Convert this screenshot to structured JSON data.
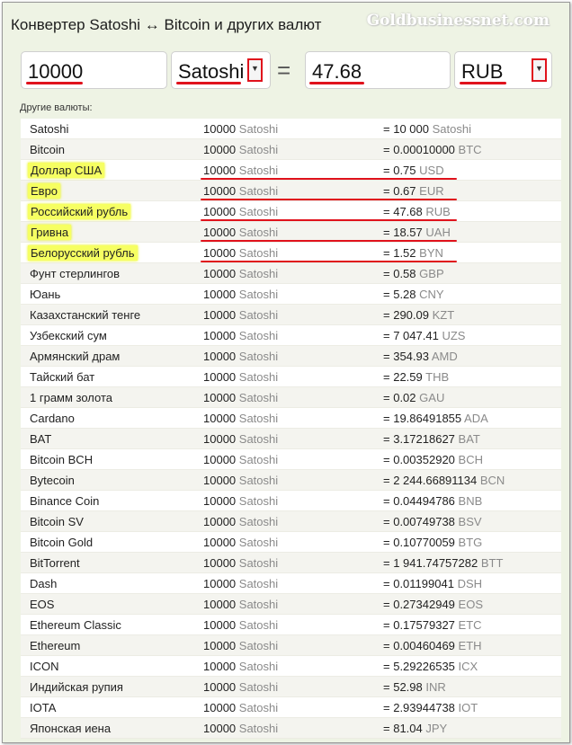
{
  "header": {
    "title": "Конвертер Satoshi ↔ Bitcoin и других валют",
    "watermark": "Goldbusinessnet.com"
  },
  "converter": {
    "amount_value": "10000",
    "from_currency": "Satoshi",
    "equals": "=",
    "result_value": "47.68",
    "to_currency": "RUB",
    "dropdown_arrow": "▼"
  },
  "others_label": "Другие валюты:",
  "colors": {
    "accent_red": "#e0121c",
    "highlight_yellow": "#f6ff62",
    "unit_gray": "#8a8a8a"
  },
  "rows": [
    {
      "name": "Satoshi",
      "amount": "10000",
      "amount_unit": "Satoshi",
      "result": "10 000",
      "unit": "Satoshi",
      "highlighted": false
    },
    {
      "name": "Bitcoin",
      "amount": "10000",
      "amount_unit": "Satoshi",
      "result": "0.00010000",
      "unit": "BTC",
      "highlighted": false
    },
    {
      "name": "Доллар США",
      "amount": "10000",
      "amount_unit": "Satoshi",
      "result": "0.75",
      "unit": "USD",
      "highlighted": true
    },
    {
      "name": "Евро",
      "amount": "10000",
      "amount_unit": "Satoshi",
      "result": "0.67",
      "unit": "EUR",
      "highlighted": true
    },
    {
      "name": "Российский рубль",
      "amount": "10000",
      "amount_unit": "Satoshi",
      "result": "47.68",
      "unit": "RUB",
      "highlighted": true
    },
    {
      "name": "Гривна",
      "amount": "10000",
      "amount_unit": "Satoshi",
      "result": "18.57",
      "unit": "UAH",
      "highlighted": true
    },
    {
      "name": "Белорусский рубль",
      "amount": "10000",
      "amount_unit": "Satoshi",
      "result": "1.52",
      "unit": "BYN",
      "highlighted": true
    },
    {
      "name": "Фунт стерлингов",
      "amount": "10000",
      "amount_unit": "Satoshi",
      "result": "0.58",
      "unit": "GBP",
      "highlighted": false
    },
    {
      "name": "Юань",
      "amount": "10000",
      "amount_unit": "Satoshi",
      "result": "5.28",
      "unit": "CNY",
      "highlighted": false
    },
    {
      "name": "Казахстанский тенге",
      "amount": "10000",
      "amount_unit": "Satoshi",
      "result": "290.09",
      "unit": "KZT",
      "highlighted": false
    },
    {
      "name": "Узбекский сум",
      "amount": "10000",
      "amount_unit": "Satoshi",
      "result": "7 047.41",
      "unit": "UZS",
      "highlighted": false
    },
    {
      "name": "Армянский драм",
      "amount": "10000",
      "amount_unit": "Satoshi",
      "result": "354.93",
      "unit": "AMD",
      "highlighted": false
    },
    {
      "name": "Тайский бат",
      "amount": "10000",
      "amount_unit": "Satoshi",
      "result": "22.59",
      "unit": "THB",
      "highlighted": false
    },
    {
      "name": "1 грамм золота",
      "amount": "10000",
      "amount_unit": "Satoshi",
      "result": "0.02",
      "unit": "GAU",
      "highlighted": false
    },
    {
      "name": "Cardano",
      "amount": "10000",
      "amount_unit": "Satoshi",
      "result": "19.86491855",
      "unit": "ADA",
      "highlighted": false
    },
    {
      "name": "BAT",
      "amount": "10000",
      "amount_unit": "Satoshi",
      "result": "3.17218627",
      "unit": "BAT",
      "highlighted": false
    },
    {
      "name": "Bitcoin BCH",
      "amount": "10000",
      "amount_unit": "Satoshi",
      "result": "0.00352920",
      "unit": "BCH",
      "highlighted": false
    },
    {
      "name": "Bytecoin",
      "amount": "10000",
      "amount_unit": "Satoshi",
      "result": "2 244.66891134",
      "unit": "BCN",
      "highlighted": false
    },
    {
      "name": "Binance Coin",
      "amount": "10000",
      "amount_unit": "Satoshi",
      "result": "0.04494786",
      "unit": "BNB",
      "highlighted": false
    },
    {
      "name": "Bitcoin SV",
      "amount": "10000",
      "amount_unit": "Satoshi",
      "result": "0.00749738",
      "unit": "BSV",
      "highlighted": false
    },
    {
      "name": "Bitcoin Gold",
      "amount": "10000",
      "amount_unit": "Satoshi",
      "result": "0.10770059",
      "unit": "BTG",
      "highlighted": false
    },
    {
      "name": "BitTorrent",
      "amount": "10000",
      "amount_unit": "Satoshi",
      "result": "1 941.74757282",
      "unit": "BTT",
      "highlighted": false
    },
    {
      "name": "Dash",
      "amount": "10000",
      "amount_unit": "Satoshi",
      "result": "0.01199041",
      "unit": "DSH",
      "highlighted": false
    },
    {
      "name": "EOS",
      "amount": "10000",
      "amount_unit": "Satoshi",
      "result": "0.27342949",
      "unit": "EOS",
      "highlighted": false
    },
    {
      "name": "Ethereum Classic",
      "amount": "10000",
      "amount_unit": "Satoshi",
      "result": "0.17579327",
      "unit": "ETC",
      "highlighted": false
    },
    {
      "name": "Ethereum",
      "amount": "10000",
      "amount_unit": "Satoshi",
      "result": "0.00460469",
      "unit": "ETH",
      "highlighted": false
    },
    {
      "name": "ICON",
      "amount": "10000",
      "amount_unit": "Satoshi",
      "result": "5.29226535",
      "unit": "ICX",
      "highlighted": false
    },
    {
      "name": "Индийская рупия",
      "amount": "10000",
      "amount_unit": "Satoshi",
      "result": "52.98",
      "unit": "INR",
      "highlighted": false
    },
    {
      "name": "IOTA",
      "amount": "10000",
      "amount_unit": "Satoshi",
      "result": "2.93944738",
      "unit": "IOT",
      "highlighted": false
    },
    {
      "name": "Японская иена",
      "amount": "10000",
      "amount_unit": "Satoshi",
      "result": "81.04",
      "unit": "JPY",
      "highlighted": false
    }
  ]
}
